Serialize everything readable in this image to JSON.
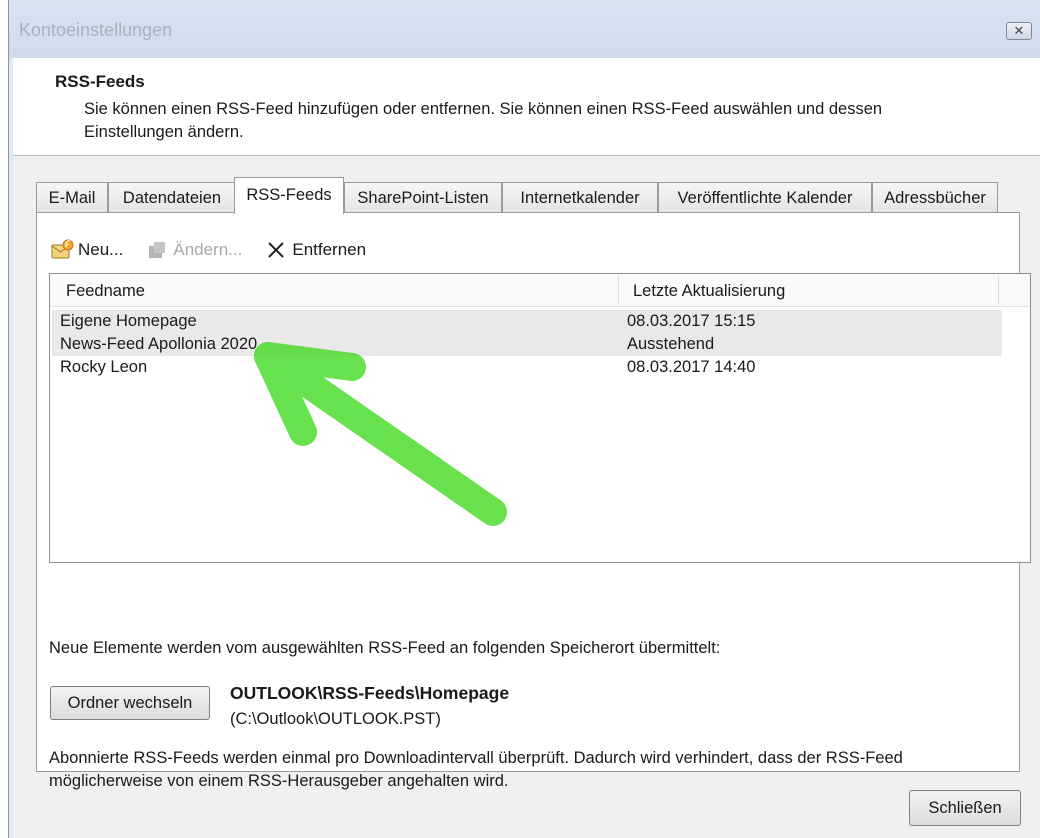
{
  "window": {
    "title": "Kontoeinstellungen",
    "close_glyph": "✕"
  },
  "header": {
    "title": "RSS-Feeds",
    "description": "Sie können einen RSS-Feed hinzufügen oder entfernen. Sie können einen RSS-Feed auswählen und dessen Einstellungen ändern."
  },
  "tabs": [
    {
      "label": "E-Mail"
    },
    {
      "label": "Datendateien"
    },
    {
      "label": "RSS-Feeds"
    },
    {
      "label": "SharePoint-Listen"
    },
    {
      "label": "Internetkalender"
    },
    {
      "label": "Veröffentlichte Kalender"
    },
    {
      "label": "Adressbücher"
    }
  ],
  "active_tab": "RSS-Feeds",
  "toolbar": {
    "new_label": "Neu...",
    "new_icon": "new-feed-icon",
    "edit_label": "Ändern...",
    "edit_icon": "edit-icon",
    "remove_label": "Entfernen",
    "remove_icon": "close-x-icon"
  },
  "feed_list": {
    "columns": [
      "Feedname",
      "Letzte Aktualisierung"
    ],
    "rows": [
      {
        "name": "Eigene Homepage",
        "updated": "08.03.2017 15:15",
        "selected": true
      },
      {
        "name": "News-Feed Apollonia 2020",
        "updated": "Ausstehend",
        "selected": true
      },
      {
        "name": "Rocky Leon",
        "updated": "08.03.2017 14:40",
        "selected": false
      }
    ]
  },
  "delivery": {
    "info": "Neue Elemente werden vom ausgewählten RSS-Feed an folgenden Speicherort übermittelt:",
    "change_button": "Ordner wechseln",
    "path": "OUTLOOK\\RSS-Feeds\\Homepage",
    "file": "(C:\\Outlook\\OUTLOOK.PST)"
  },
  "note": "Abonnierte RSS-Feeds werden einmal pro Downloadintervall überprüft. Dadurch wird verhindert, dass der RSS-Feed möglicherweise von einem RSS-Herausgeber angehalten wird.",
  "footer": {
    "close_button": "Schließen"
  },
  "annotation": {
    "arrow_color": "#4ddc2e"
  }
}
